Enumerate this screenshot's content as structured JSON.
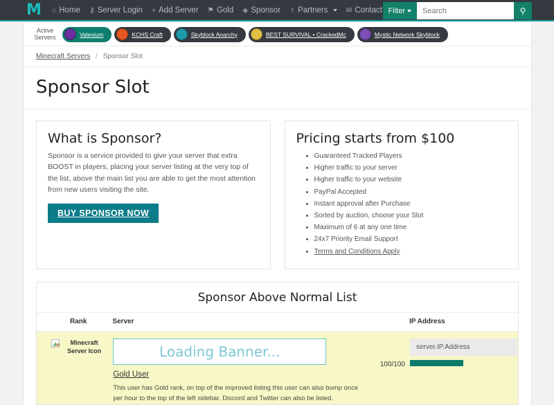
{
  "navbar": {
    "logo": "M",
    "links": [
      {
        "icon": "home-icon",
        "glyph": "⌂",
        "label": "Home"
      },
      {
        "icon": "key-icon",
        "glyph": "⚷",
        "label": "Server Login"
      },
      {
        "icon": "plus-icon",
        "glyph": "+",
        "label": "Add Server"
      },
      {
        "icon": "tag-icon",
        "glyph": "⚑",
        "label": "Gold"
      },
      {
        "icon": "diamond-icon",
        "glyph": "◈",
        "label": "Sponsor"
      },
      {
        "icon": "handshake-icon",
        "glyph": "☿",
        "label": "Partners",
        "caret": true
      },
      {
        "icon": "envelope-icon",
        "glyph": "✉",
        "label": "Contact"
      }
    ],
    "filter_label": "Filter",
    "search_placeholder": "Search",
    "search_value": "",
    "search_icon": "search-icon",
    "search_glyph": "⚲"
  },
  "active_servers": {
    "label_line1": "Active",
    "label_line2": "Servers",
    "pills": [
      {
        "name": "Valexium",
        "active": true,
        "icon_color": "#6b2fa0"
      },
      {
        "name": "KCHS Craft",
        "active": false,
        "icon_color": "#e8561f"
      },
      {
        "name": "Skyblock Anarchy",
        "active": false,
        "icon_color": "#1e9aa8"
      },
      {
        "name": "BEST SURVIVAL • CrackedMc",
        "active": false,
        "icon_color": "#e2c044"
      },
      {
        "name": "Mystic Network Skyblock",
        "active": false,
        "icon_color": "#7b4fb5"
      }
    ]
  },
  "breadcrumb": {
    "root": "Minecraft Servers",
    "separator": "/",
    "current": "Sponsor Slot"
  },
  "page_title": "Sponsor Slot",
  "what_is_sponsor": {
    "heading": "What is Sponsor?",
    "body": "Sponsor is a service provided to give your server that extra BOOST in players, placing your server listing at the very top of the list, above the main list you are able to get the most attention from new users visiting the site.",
    "button_label": "BUY SPONSOR NOW"
  },
  "pricing": {
    "heading": "Pricing starts from $100",
    "items": [
      "Guaranteed Tracked Players",
      "Higher traffic to your server",
      "Higher traffic to your website",
      "PayPal Accepted",
      "Instant approval after Purchase",
      "Sorted by auction, choose your Slot",
      "Maximum of 6 at any one time",
      "24x7 Priority Email Support"
    ],
    "terms_link": "Terms and Conditions Apply"
  },
  "sponsor_list": {
    "title": "Sponsor Above Normal List",
    "columns": {
      "rank": "Rank",
      "server": "Server",
      "ip": "IP Address"
    },
    "row": {
      "icon_alt_line1": "Minecraft Server",
      "icon_alt_line2": "Icon",
      "banner_text": "Loading Banner...",
      "server_name": "Gold User",
      "description": "This user has Gold rank, on top of the improved listing this user can also bump once per hour to the top of the left sidebar. Discord and Twitter can also be listed.",
      "players": "100/100",
      "ip_value": "server.IP.Address"
    }
  },
  "colors": {
    "brand_teal": "#138069",
    "navbar_dark": "#343a40",
    "logo_teal": "#1abcbc",
    "buy_button": "#0c7b8a",
    "gold_row": "#f7f7c8",
    "banner_border": "#69c3c9"
  }
}
